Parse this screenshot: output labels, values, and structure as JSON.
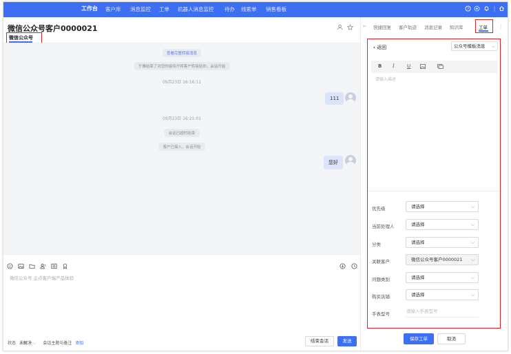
{
  "nav": {
    "items": [
      "工作台",
      "客户库",
      "消息监控",
      "工单",
      "机器人消息监控",
      "待办",
      "线索单",
      "销售看板"
    ],
    "active_index": 0,
    "icons": [
      "help-icon",
      "settings-icon",
      "notification-icon",
      "home-icon"
    ]
  },
  "chat": {
    "title": "微信公众号客户0000021",
    "channel_tab": "微信公众号",
    "header_icons": [
      "user-icon",
      "star-icon"
    ],
    "messages": {
      "view_history": "查看完整转接消息",
      "system1": "于雅结束了对您的接待开将客户转接给你，会话开始",
      "time1": "09月23日 16:16:11",
      "bubble1": "111",
      "time2": "09月23日 16:21:01",
      "system2": "会话已超时结束",
      "system3": "客户已接入，会话开始",
      "bubble2": "您好"
    },
    "toolbar_icons": [
      "emoji-icon",
      "image-icon",
      "folder-icon",
      "user-card-icon",
      "screenshot-icon",
      "award-icon"
    ],
    "toolbar_right_icons": [
      "download-icon",
      "history-icon"
    ],
    "input_placeholder": "微信公众号 企点客户端产品体验",
    "status_label": "状态",
    "status_value": "未解决",
    "topic_label": "会话主题与备注",
    "topic_link": "添加",
    "end_button": "结束会话",
    "send_button": "发送"
  },
  "right": {
    "tabs": [
      "快捷回复",
      "客户轨迹",
      "消息记录",
      "知识库",
      "工单"
    ],
    "active_tab": 4,
    "back_label": "返回",
    "template_select": "公众号模板消息",
    "editor_tools": [
      "B",
      "I",
      "U",
      "image",
      "link"
    ],
    "editor_placeholder": "请输入描述",
    "fields": [
      {
        "label": "优先级",
        "value": "请选择",
        "type": "select"
      },
      {
        "label": "当前处理人",
        "value": "请选择",
        "type": "select"
      },
      {
        "label": "分类",
        "value": "请选择",
        "type": "select"
      },
      {
        "label": "关联客户",
        "value": "微信公众号客户0000021",
        "type": "select-disabled"
      },
      {
        "label": "问题类别",
        "value": "请选择",
        "type": "select"
      },
      {
        "label": "购买店铺",
        "value": "请选择",
        "type": "select"
      },
      {
        "label": "手表型号",
        "value": "请输入手表型号",
        "type": "input"
      }
    ],
    "save_button": "保存工单",
    "cancel_button": "取消"
  }
}
